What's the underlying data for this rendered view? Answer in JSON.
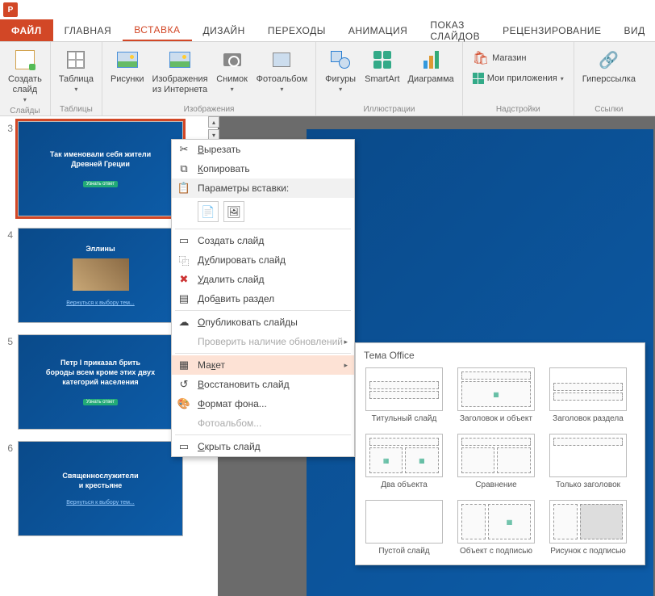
{
  "app": {
    "name": "PowerPoint"
  },
  "tabs": {
    "file": "ФАЙЛ",
    "home": "ГЛАВНАЯ",
    "insert": "ВСТАВКА",
    "design": "ДИЗАЙН",
    "transitions": "ПЕРЕХОДЫ",
    "animations": "АНИМАЦИЯ",
    "slideshow": "ПОКАЗ СЛАЙДОВ",
    "review": "РЕЦЕНЗИРОВАНИЕ",
    "view": "ВИД"
  },
  "ribbon": {
    "groups": {
      "slides": {
        "label": "Слайды",
        "new_slide": "Создать\nслайд"
      },
      "tables": {
        "label": "Таблицы",
        "table": "Таблица"
      },
      "images": {
        "label": "Изображения",
        "pictures": "Рисунки",
        "online": "Изображения\nиз Интернета",
        "screenshot": "Снимок",
        "album": "Фотоальбом"
      },
      "illustrations": {
        "label": "Иллюстрации",
        "shapes": "Фигуры",
        "smartart": "SmartArt",
        "chart": "Диаграмма"
      },
      "addins": {
        "label": "Надстройки",
        "store": "Магазин",
        "myapps": "Мои приложения"
      },
      "links": {
        "label": "Ссылки",
        "hyperlink": "Гиперссылка"
      }
    }
  },
  "thumbnails": [
    {
      "num": "3",
      "title": "Так именовали себя жители\nДревней Греции",
      "button": "Узнать ответ",
      "selected": true
    },
    {
      "num": "4",
      "title": "Эллины",
      "sub": "Вернуться к выбору тем...",
      "image": true
    },
    {
      "num": "5",
      "title": "Петр I приказал брить\nбороды всем кроме этих двух\nкатегорий населения",
      "button": "Узнать ответ"
    },
    {
      "num": "6",
      "title": "Священнослужители\nи крестьяне",
      "sub": "Вернуться к выбору тем..."
    }
  ],
  "context_menu": {
    "cut": "Вырезать",
    "copy": "Копировать",
    "paste_header": "Параметры вставки:",
    "new_slide": "Создать слайд",
    "duplicate": "Дублировать слайд",
    "delete": "Удалить слайд",
    "add_section": "Добавить раздел",
    "publish": "Опубликовать слайды",
    "check_updates": "Проверить наличие обновлений",
    "layout": "Макет",
    "reset": "Восстановить слайд",
    "format_bg": "Формат фона...",
    "photoalbum": "Фотоальбом...",
    "hide": "Скрыть слайд"
  },
  "layout_panel": {
    "title": "Тема Office",
    "items": [
      "Титульный слайд",
      "Заголовок и объект",
      "Заголовок раздела",
      "Два объекта",
      "Сравнение",
      "Только заголовок",
      "Пустой слайд",
      "Объект с подписью",
      "Рисунок с подписью"
    ]
  }
}
